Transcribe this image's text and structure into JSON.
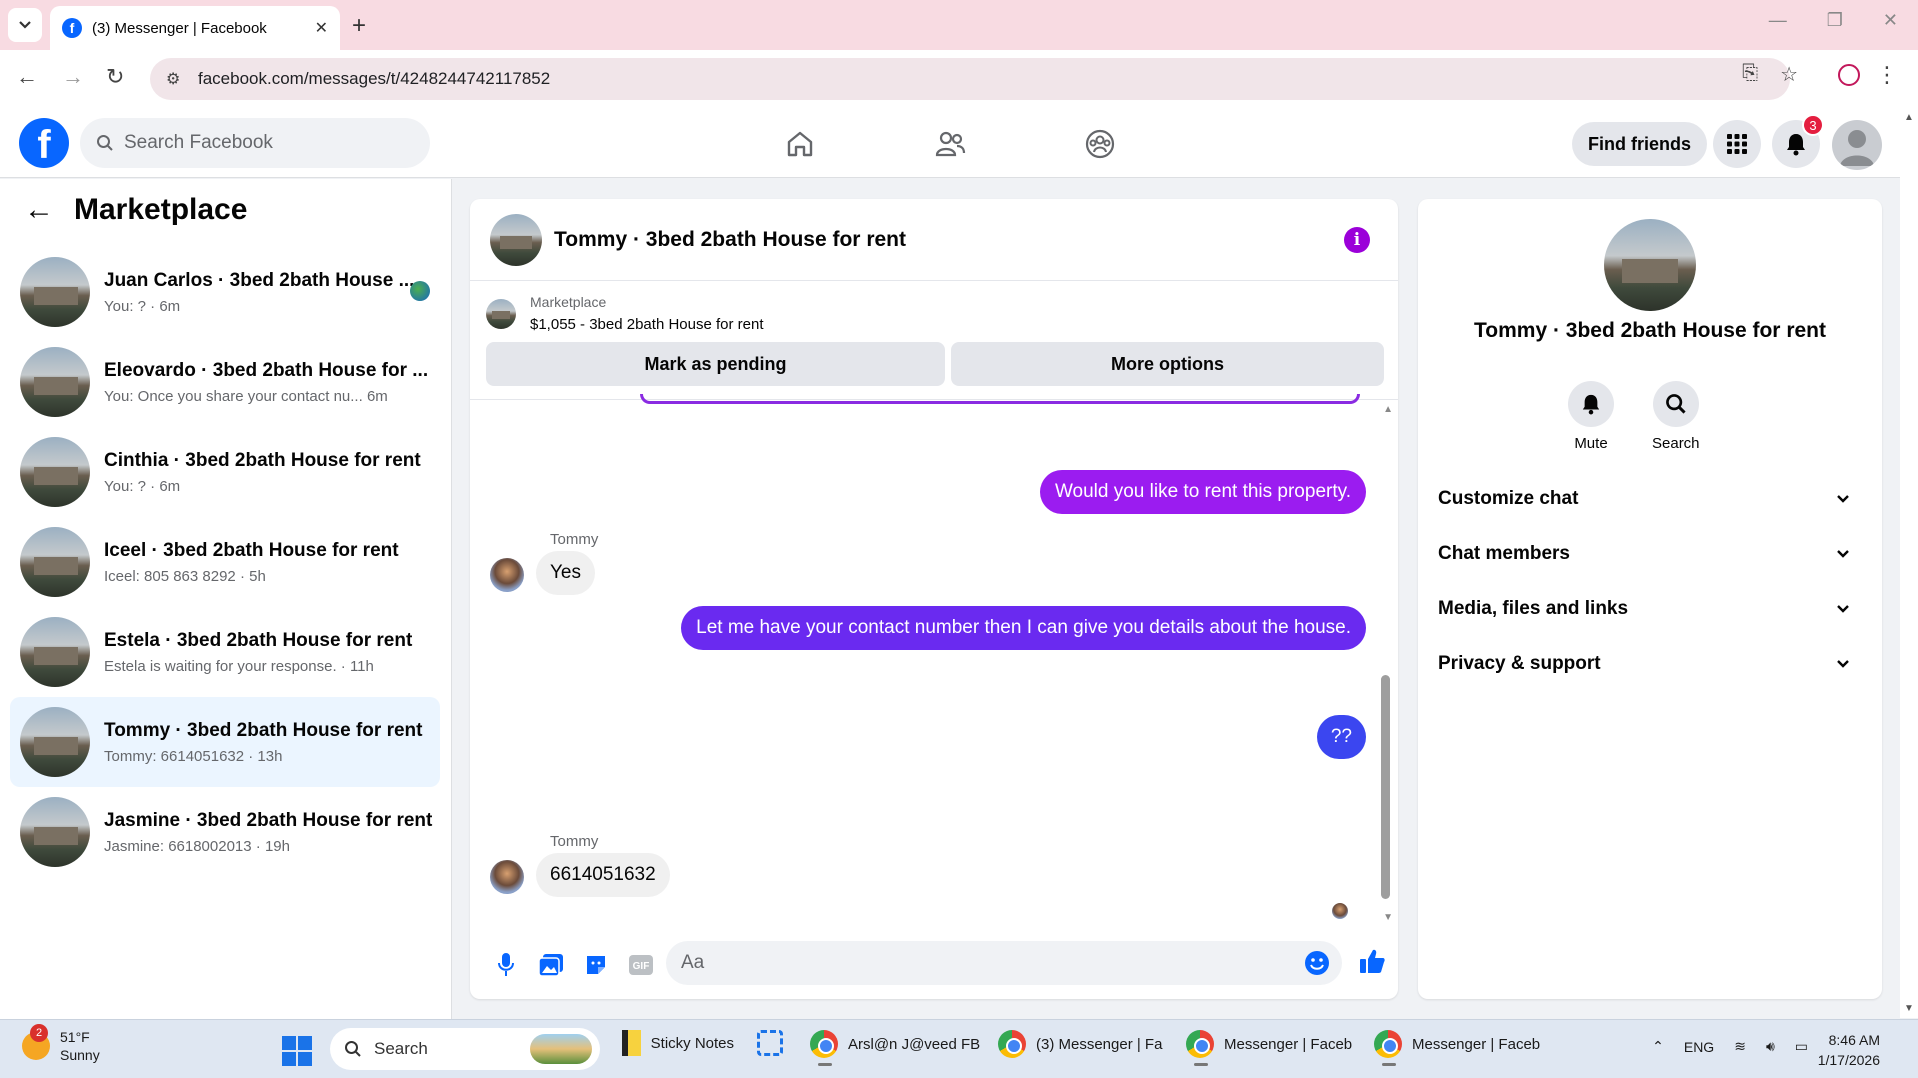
{
  "browser": {
    "tab_title": "(3) Messenger | Facebook",
    "url": "facebook.com/messages/t/4248244742117852"
  },
  "header": {
    "search_placeholder": "Search Facebook",
    "find_friends": "Find friends",
    "notif_count": "3"
  },
  "sidebar": {
    "title": "Marketplace",
    "conversations": [
      {
        "name": "Juan Carlos · 3bed 2bath House ...",
        "sub": "You: ? · 6m"
      },
      {
        "name": "Eleovardo · 3bed 2bath House for ...",
        "sub": "You: Once you share your contact nu...   6m"
      },
      {
        "name": "Cinthia · 3bed 2bath House for rent",
        "sub": "You: ? · 6m"
      },
      {
        "name": "Iceel · 3bed 2bath House for rent",
        "sub": "Iceel: 805 863 8292 · 5h"
      },
      {
        "name": "Estela · 3bed 2bath House for rent",
        "sub": "Estela is waiting for your response. · 11h"
      },
      {
        "name": "Tommy · 3bed 2bath House for rent",
        "sub": "Tommy: 6614051632 · 13h"
      },
      {
        "name": "Jasmine · 3bed 2bath House for rent",
        "sub": "Jasmine: 6618002013 · 19h"
      }
    ]
  },
  "chat": {
    "title": "Tommy · 3bed 2bath House for rent",
    "marketplace_label": "Marketplace",
    "listing": "$1,055 - 3bed 2bath House for rent",
    "mark_pending": "Mark as pending",
    "more_options": "More options",
    "messages": {
      "out1": "Would you like to rent this property.",
      "in1_name": "Tommy",
      "in1": "Yes",
      "out2": "Let me have your contact number then I can give you details about the house.",
      "out3": "??",
      "in2_name": "Tommy",
      "in2": "6614051632"
    },
    "composer_placeholder": "Aa",
    "colors": {
      "out1": "#9b1cf0",
      "out2": "#6a2af0",
      "out3": "#3b46f0"
    }
  },
  "right_panel": {
    "name": "Tommy · 3bed 2bath House for rent",
    "mute": "Mute",
    "search": "Search",
    "sections": [
      "Customize chat",
      "Chat members",
      "Media, files and links",
      "Privacy & support"
    ]
  },
  "taskbar": {
    "temp": "51°F",
    "condition": "Sunny",
    "weather_badge": "2",
    "search": "Search",
    "apps": [
      "Sticky Notes",
      "Arsl@n J@veed FB",
      "(3) Messenger | Fa",
      "Messenger | Faceb",
      "Messenger | Faceb"
    ],
    "lang": "ENG",
    "time": "8:46 AM",
    "date": "1/17/2026"
  }
}
